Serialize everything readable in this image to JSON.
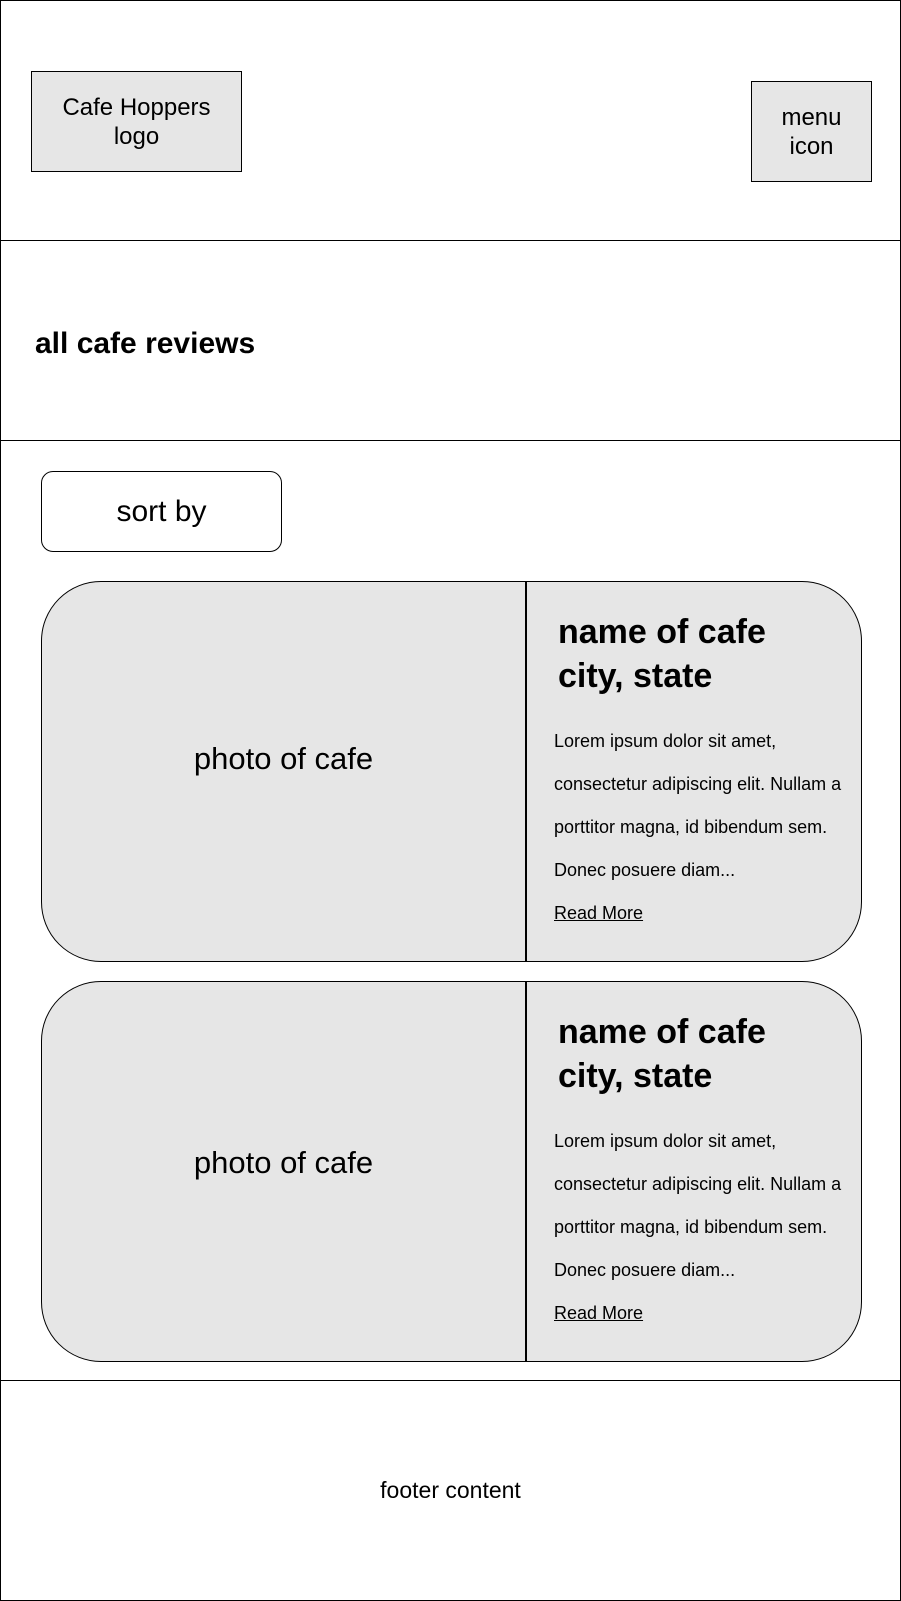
{
  "header": {
    "logo_label": "Cafe Hoppers logo",
    "menu_label": "menu icon"
  },
  "page": {
    "title": "all cafe reviews"
  },
  "controls": {
    "sort_label": "sort by"
  },
  "reviews": [
    {
      "photo_label": "photo of cafe",
      "name": "name of cafe",
      "location": "city, state",
      "excerpt": "Lorem ipsum dolor sit amet, consectetur adipiscing elit. Nullam a porttitor magna, id bibendum sem. Donec posuere diam...",
      "link_label": "Read More"
    },
    {
      "photo_label": "photo of cafe",
      "name": "name of cafe",
      "location": "city, state",
      "excerpt": "Lorem ipsum dolor sit amet, consectetur adipiscing elit. Nullam a porttitor magna, id bibendum sem. Donec posuere diam...",
      "link_label": "Read More"
    }
  ],
  "footer": {
    "text": "footer content"
  },
  "colors": {
    "placeholder_fill": "#e6e6e6",
    "border": "#000000",
    "background": "#ffffff"
  }
}
